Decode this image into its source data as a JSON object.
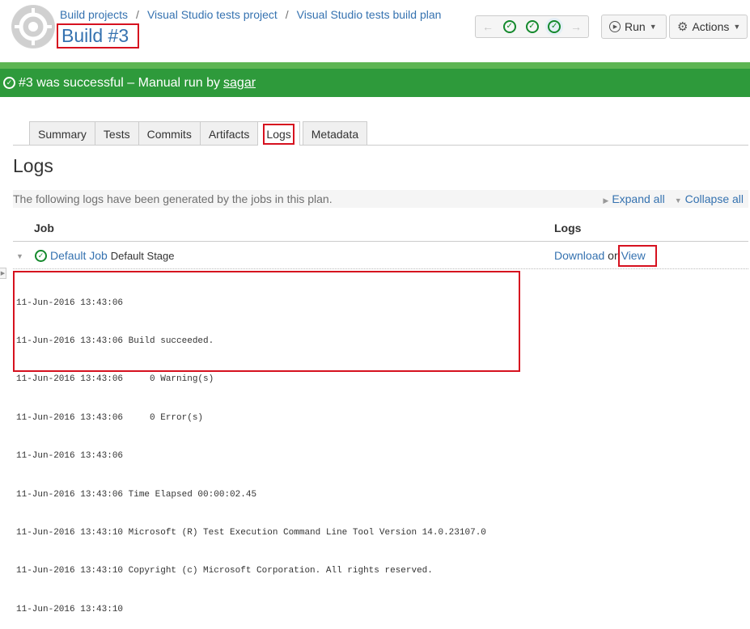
{
  "breadcrumb": [
    "Build projects",
    "Visual Studio tests project",
    "Visual Studio tests build plan"
  ],
  "build_title": "Build #3",
  "nav": {
    "prev_arrow": "←",
    "next_arrow": "→",
    "status_count": 3
  },
  "run_button": {
    "label": "Run"
  },
  "actions_button": {
    "label": "Actions"
  },
  "banner": {
    "text": "#3 was successful – Manual run by",
    "user": "sagar",
    "color": "#2e9a3b"
  },
  "tabs": [
    {
      "label": "Summary"
    },
    {
      "label": "Tests"
    },
    {
      "label": "Commits"
    },
    {
      "label": "Artifacts"
    },
    {
      "label": "Logs"
    },
    {
      "label": "Metadata"
    }
  ],
  "page_heading": "Logs",
  "info": {
    "text": "The following logs have been generated by the jobs in this plan.",
    "expand_all": "Expand all",
    "collapse_all": "Collapse all"
  },
  "table": {
    "col_job": "Job",
    "col_logs": "Logs"
  },
  "job": {
    "name": "Default Job",
    "stage": "Default Stage",
    "download": "Download",
    "or": "or",
    "view": "View"
  },
  "log_lines": [
    "11-Jun-2016 13:43:06",
    "11-Jun-2016 13:43:06 Build succeeded.",
    "11-Jun-2016 13:43:06     0 Warning(s)",
    "11-Jun-2016 13:43:06     0 Error(s)",
    "11-Jun-2016 13:43:06",
    "11-Jun-2016 13:43:06 Time Elapsed 00:00:02.45",
    "11-Jun-2016 13:43:10 Microsoft (R) Test Execution Command Line Tool Version 14.0.23107.0",
    "11-Jun-2016 13:43:10 Copyright (c) Microsoft Corporation. All rights reserved.",
    "11-Jun-2016 13:43:10"
  ]
}
